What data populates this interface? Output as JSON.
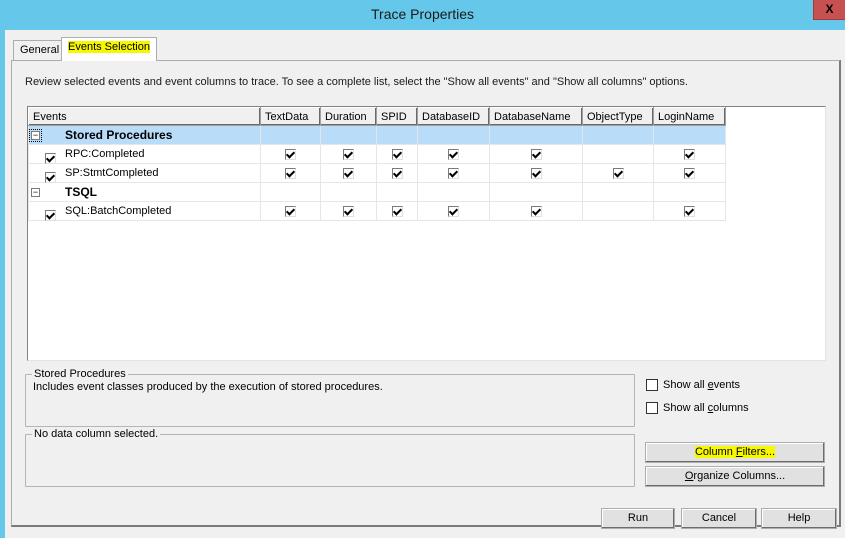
{
  "window": {
    "title": "Trace Properties",
    "close_label": "X"
  },
  "tabs": [
    {
      "label": "General",
      "active": false
    },
    {
      "label": "Events Selection",
      "active": true,
      "highlighted": true
    }
  ],
  "instructions": "Review selected events and event columns to trace. To see a complete list, select the \"Show all events\" and \"Show all columns\" options.",
  "grid": {
    "columns": [
      "Events",
      "TextData",
      "Duration",
      "SPID",
      "DatabaseID",
      "DatabaseName",
      "ObjectType",
      "LoginName"
    ],
    "categories": [
      {
        "name": "Stored Procedures",
        "expander": "−",
        "selected": true,
        "events": [
          {
            "name": "RPC:Completed",
            "checked": true,
            "columns": [
              true,
              true,
              true,
              true,
              true,
              false,
              true
            ]
          },
          {
            "name": "SP:StmtCompleted",
            "checked": true,
            "columns": [
              true,
              true,
              true,
              true,
              true,
              true,
              true
            ]
          }
        ]
      },
      {
        "name": "TSQL",
        "expander": "−",
        "selected": false,
        "events": [
          {
            "name": "SQL:BatchCompleted",
            "checked": true,
            "columns": [
              true,
              true,
              true,
              true,
              true,
              false,
              true
            ]
          }
        ]
      }
    ]
  },
  "description_box": {
    "title": "Stored Procedures",
    "text": "Includes event classes produced by the execution of stored procedures."
  },
  "column_box": {
    "title": "No data column selected."
  },
  "options": {
    "show_all_events": {
      "pre": "Show all ",
      "accel": "e",
      "post": "vents",
      "checked": false
    },
    "show_all_columns": {
      "pre": "Show all ",
      "accel": "c",
      "post": "olumns",
      "checked": false
    }
  },
  "buttons": {
    "column_filters": {
      "pre": "Column ",
      "accel": "F",
      "post": "ilters...",
      "highlighted": true
    },
    "organize_columns": {
      "pre": "",
      "accel": "O",
      "post": "rganize Columns..."
    },
    "run": "Run",
    "cancel": "Cancel",
    "help": "Help"
  },
  "colors": {
    "titlebar": "#65c8ea",
    "close_button": "#c75050",
    "selected_row": "#b9dcf8",
    "highlight": "#f7f700"
  }
}
